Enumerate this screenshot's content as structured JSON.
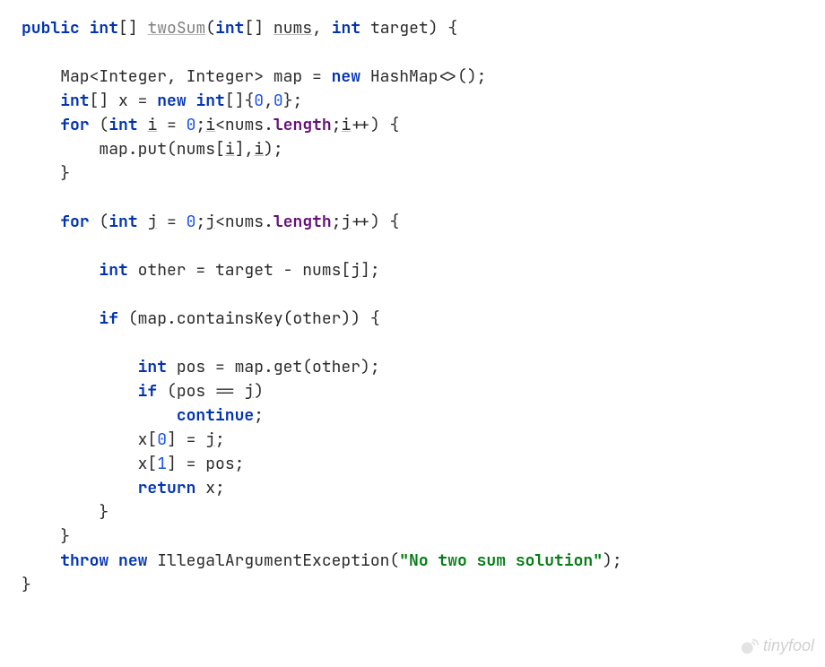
{
  "code": {
    "sig_public": "public",
    "sig_int": "int",
    "sig_brackets": "[]",
    "sig_fn": "twoSum",
    "sig_param_nums": "nums",
    "sig_param_target": "target",
    "map_decl_left": "Map<Integer, Integer> map = ",
    "new_kw": "new",
    "map_decl_right": " HashMap<>();",
    "x_decl_left": "[] x = ",
    "x_decl_mid": "[]{",
    "zero": "0",
    "one": "1",
    "for_kw": "for",
    "i_var": "i",
    "j_var": "j",
    "nums_var": "nums",
    "length_field": "length",
    "map_put_left": "map.put(nums[",
    "map_put_right": "],",
    "other_decl_left": " other = target - nums[",
    "if_kw": "if",
    "contains_left": " (map.containsKey(other)) {",
    "pos_decl": " pos = map.get(other);",
    "pos_eq": " (pos == ",
    "continue_kw": "continue",
    "x0_assign_left": "x[",
    "x0_assign_close": "] = ",
    "return_kw": "return",
    "return_stmt": " x;",
    "throw_kw": "throw",
    "exception_class": " IllegalArgumentException(",
    "exception_msg": "\"No two sum solution\"",
    "close_paren": ");"
  },
  "watermark": "tinyfool"
}
